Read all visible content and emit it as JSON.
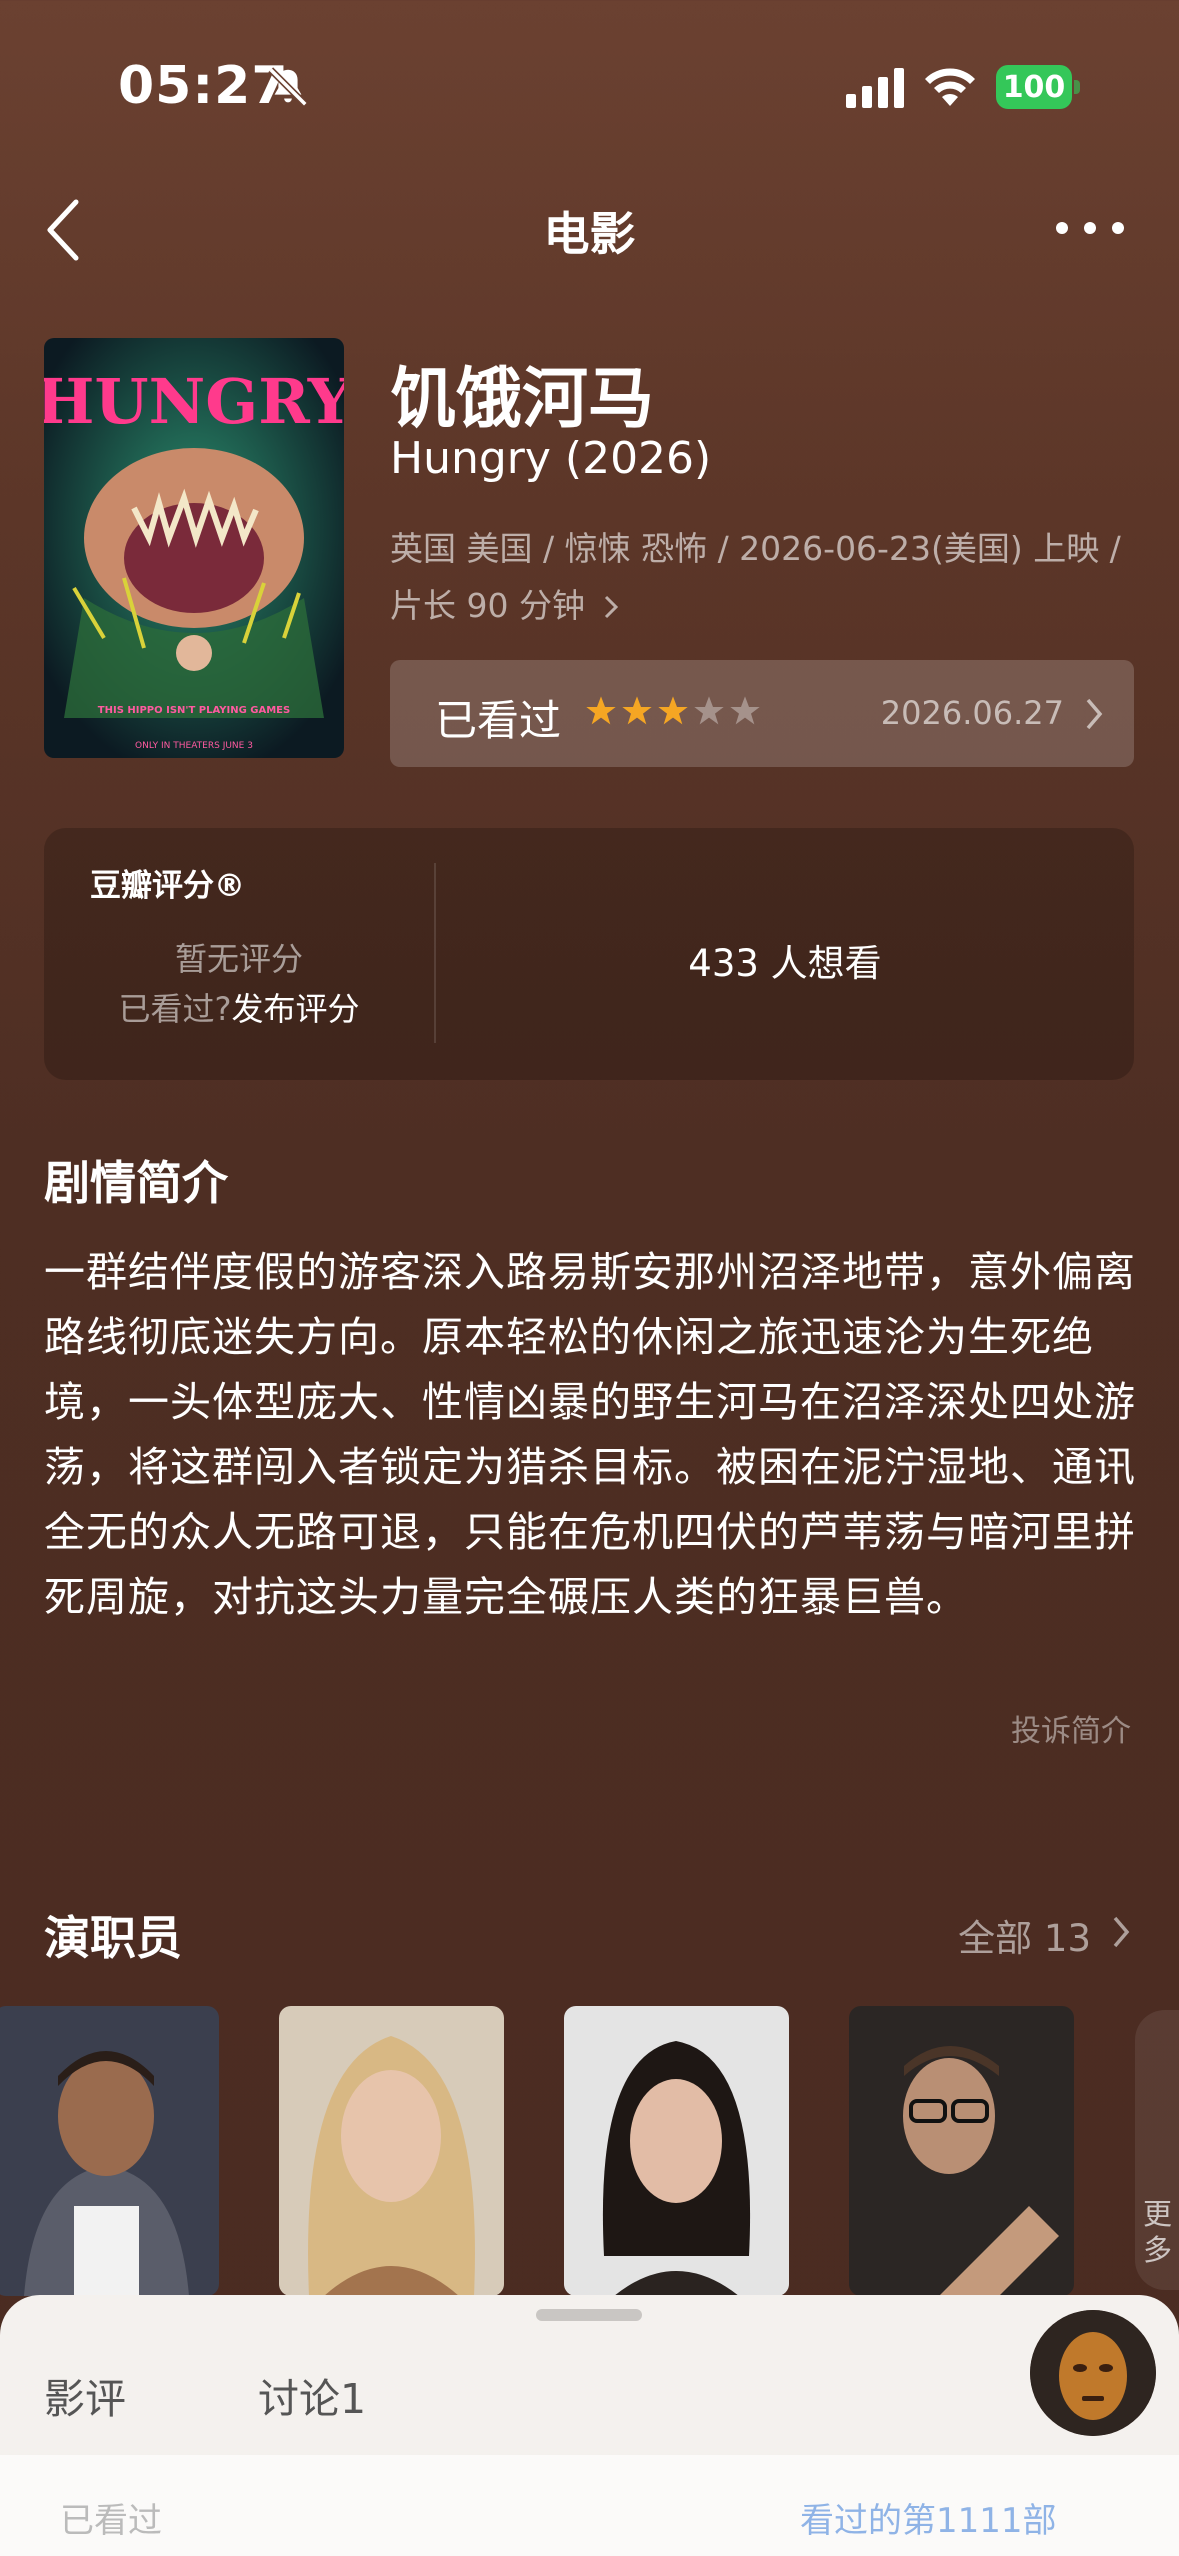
{
  "status_bar": {
    "time": "05:27",
    "battery": "100"
  },
  "nav": {
    "title": "电影"
  },
  "movie": {
    "title_cn": "饥饿河马",
    "title_en": "Hungry (2026)",
    "meta_line1": "英国 美国 / 惊悚 恐怖 / 2026-06-23(美国) 上映 /",
    "meta_line2": "片长 90 分钟",
    "poster": {
      "title": "HUNGRY",
      "tagline": "THIS HIPPO ISN'T PLAYING GAMES",
      "footer": "ONLY IN THEATERS JUNE 3"
    }
  },
  "watched": {
    "label": "已看过",
    "stars": 3,
    "max_stars": 5,
    "date": "2026.06.27"
  },
  "rating": {
    "title": "豆瓣评分®",
    "no_rating": "暂无评分",
    "seen_question": "已看过?",
    "publish": "发布评分",
    "want_count": "433 人想看"
  },
  "synopsis": {
    "title": "剧情简介",
    "text": "一群结伴度假的游客深入路易斯安那州沼泽地带，意外偏离路线彻底迷失方向。原本轻松的休闲之旅迅速沦为生死绝境，一头体型庞大、性情凶暴的野生河马在沼泽深处四处游荡，将这群闯入者锁定为猎杀目标。被困在泥泞湿地、通讯全无的众人无路可退，只能在危机四伏的芦苇荡与暗河里拼死周旋，对抗这头力量完全碾压人类的狂暴巨兽。",
    "report": "投诉简介"
  },
  "cast": {
    "title": "演职员",
    "all_label": "全部 13",
    "more_label": "更多"
  },
  "sheet": {
    "tabs": [
      "影评",
      "讨论1"
    ],
    "row_left": "已看过",
    "row_right": "看过的第1111部"
  },
  "colors": {
    "accent_star": "#f5a623",
    "battery": "#34c759",
    "background": "#5c3628"
  }
}
